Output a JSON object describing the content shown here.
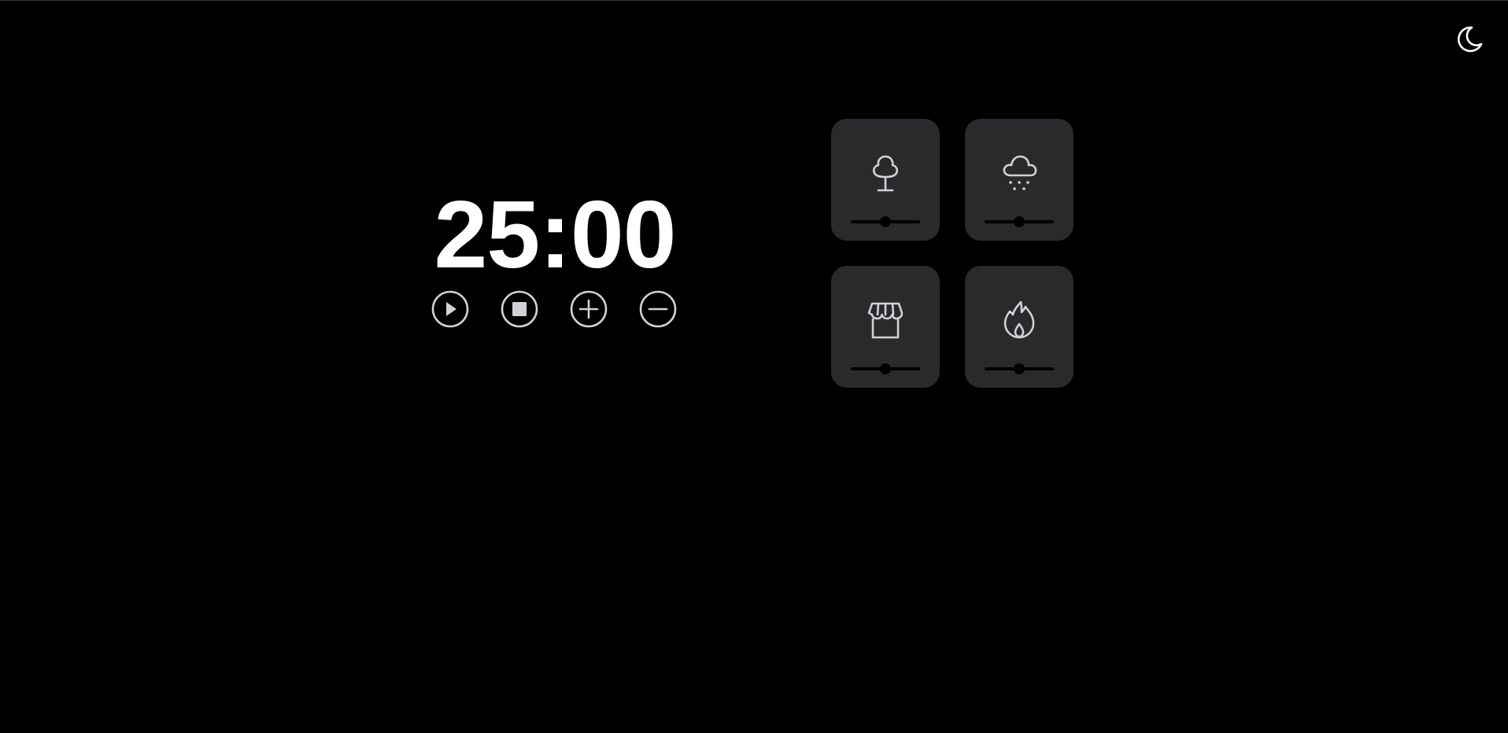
{
  "timer": {
    "display": "25:00"
  },
  "controls": [
    {
      "name": "play-button",
      "icon": "play-icon"
    },
    {
      "name": "stop-button",
      "icon": "stop-icon"
    },
    {
      "name": "add-time-button",
      "icon": "plus-icon"
    },
    {
      "name": "subtract-time-button",
      "icon": "minus-icon"
    }
  ],
  "theme_toggle": {
    "icon": "moon-icon"
  },
  "sounds": [
    {
      "name": "forest",
      "icon": "tree-icon",
      "volume": 0.5
    },
    {
      "name": "rain",
      "icon": "cloud-rain-icon",
      "volume": 0.5
    },
    {
      "name": "coffee-shop",
      "icon": "storefront-icon",
      "volume": 0.5
    },
    {
      "name": "fireplace",
      "icon": "flame-icon",
      "volume": 0.5
    }
  ],
  "colors": {
    "background": "#000000",
    "tile": "#2a2a2d",
    "icon_stroke": "#d1d1d6",
    "text": "#ffffff"
  }
}
